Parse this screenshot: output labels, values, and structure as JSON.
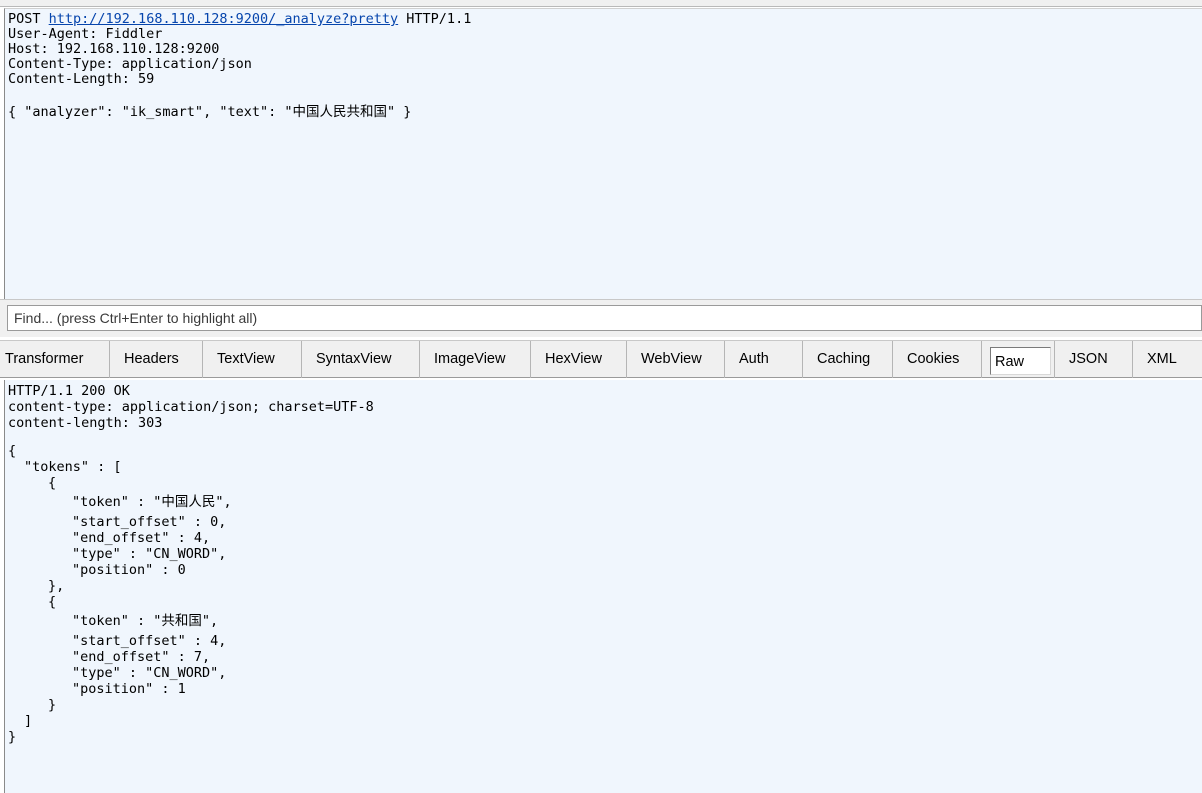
{
  "request": {
    "method": "POST",
    "url": "http://192.168.110.128:9200/_analyze?pretty",
    "protocol": "HTTP/1.1",
    "headers": [
      "User-Agent: Fiddler",
      "Host: 192.168.110.128:9200",
      "Content-Type: application/json",
      "Content-Length: 59"
    ],
    "body": "{ \"analyzer\": \"ik_smart\", \"text\": \"中国人民共和国\" }"
  },
  "find": {
    "placeholder": "Find... (press Ctrl+Enter to highlight all)"
  },
  "tabs": [
    {
      "label": "Transformer"
    },
    {
      "label": "Headers"
    },
    {
      "label": "TextView"
    },
    {
      "label": "SyntaxView"
    },
    {
      "label": "ImageView"
    },
    {
      "label": "HexView"
    },
    {
      "label": "WebView"
    },
    {
      "label": "Auth"
    },
    {
      "label": "Caching"
    },
    {
      "label": "Cookies"
    },
    {
      "label": "Raw"
    },
    {
      "label": "JSON"
    },
    {
      "label": "XML"
    }
  ],
  "active_tab": "Raw",
  "response": {
    "status": "HTTP/1.1 200 OK",
    "headers": [
      "content-type: application/json; charset=UTF-8",
      "content-length: 303"
    ],
    "lines": {
      "open_brace": "{",
      "tokens_key": "\"tokens\" : [",
      "obj_open": "{",
      "t1_token": "\"token\" : \"中国人民\",",
      "t1_start": "\"start_offset\" : 0,",
      "t1_end": "\"end_offset\" : 4,",
      "t1_type": "\"type\" : \"CN_WORD\",",
      "t1_pos": "\"position\" : 0",
      "obj_close_comma": "},",
      "t2_token": "\"token\" : \"共和国\",",
      "t2_start": "\"start_offset\" : 4,",
      "t2_end": "\"end_offset\" : 7,",
      "t2_type": "\"type\" : \"CN_WORD\",",
      "t2_pos": "\"position\" : 1",
      "obj_close": "}",
      "array_close": "]",
      "close_brace": "}"
    }
  }
}
